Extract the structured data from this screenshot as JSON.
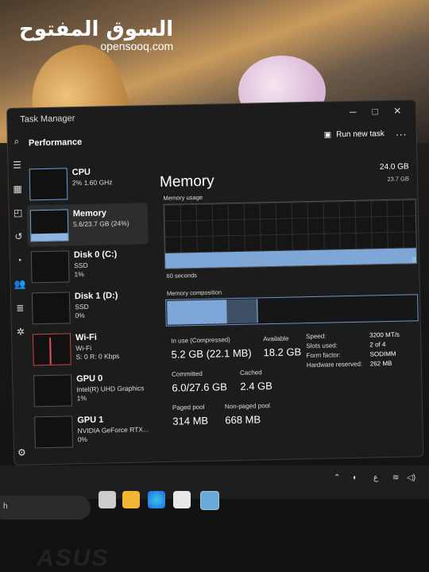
{
  "watermark": {
    "arabic": "السوق المفتوح",
    "english": "opensooq.com"
  },
  "window": {
    "title": "Task Manager",
    "controls": {
      "minimize": "─",
      "maximize": "□",
      "close": "✕"
    }
  },
  "header": {
    "section": "Performance",
    "run_task": "Run new task",
    "more": "···"
  },
  "items": [
    {
      "name": "CPU",
      "sub1": "2% 1.60 GHz"
    },
    {
      "name": "Memory",
      "sub1": "5.6/23.7 GB (24%)",
      "usage_fraction": 0.24
    },
    {
      "name": "Disk 0 (C:)",
      "sub1": "SSD",
      "sub2": "1%"
    },
    {
      "name": "Disk 1 (D:)",
      "sub1": "SSD",
      "sub2": "0%"
    },
    {
      "name": "Wi-Fi",
      "sub1": "Wi-Fi",
      "sub2": "S: 0 R: 0 Kbps"
    },
    {
      "name": "GPU 0",
      "sub1": "Intel(R) UHD Graphics",
      "sub2": "1%"
    },
    {
      "name": "GPU 1",
      "sub1": "NVIDIA GeForce RTX...",
      "sub2": "0%"
    }
  ],
  "detail": {
    "title": "Memory",
    "total": "24.0 GB",
    "usable": "23.7 GB",
    "usage_label": "Memory usage",
    "graph_max": "23.7 GB",
    "graph_min": "0",
    "time_label": "60 seconds",
    "composition_label": "Memory composition",
    "graph_fill_fraction": 0.24,
    "composition": {
      "in_use_fraction": 0.24,
      "modified_fraction": 0.12
    },
    "stats": {
      "in_use_label": "In use (Compressed)",
      "in_use": "5.2 GB (22.1 MB)",
      "available_label": "Available",
      "available": "18.2 GB",
      "committed_label": "Committed",
      "committed": "6.0/27.6 GB",
      "cached_label": "Cached",
      "cached": "2.4 GB",
      "paged_label": "Paged pool",
      "paged": "314 MB",
      "nonpaged_label": "Non-paged pool",
      "nonpaged": "668 MB"
    },
    "specs": {
      "speed_label": "Speed:",
      "speed": "3200 MT/s",
      "slots_label": "Slots used:",
      "slots": "2 of 4",
      "form_label": "Form factor:",
      "form": "SODIMM",
      "reserved_label": "Hardware reserved:",
      "reserved": "262 MB"
    }
  },
  "taskbar": {
    "search_text": "h",
    "tray_lang": "ع"
  },
  "brand": "ASUS",
  "colors": {
    "accent": "#7ea7d8",
    "window_bg": "#1c1c1c"
  }
}
